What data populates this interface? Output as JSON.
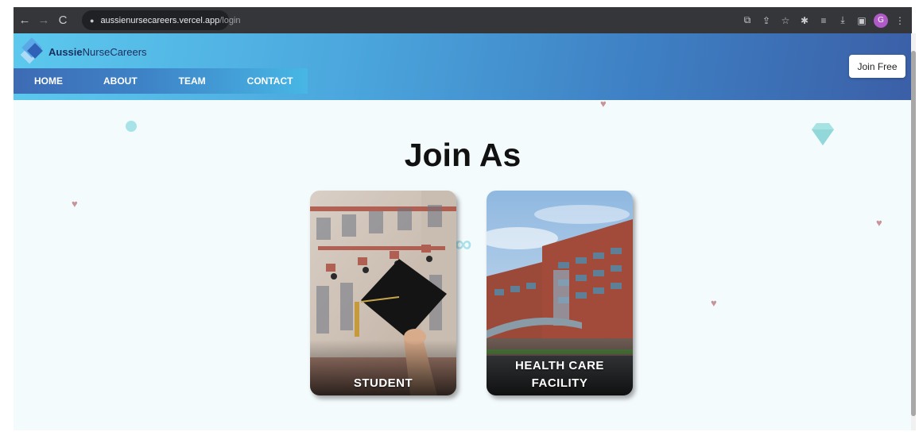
{
  "browser": {
    "url_host": "aussienursecareers.vercel.app",
    "url_path": "/login",
    "back_icon": "←",
    "forward_icon": "→",
    "reload_icon": "C",
    "lock_icon": "🔒",
    "toolbar_icons": [
      "⧉",
      "⇪",
      "☆",
      "✱",
      "≡",
      "⤓",
      "▣",
      "⋮"
    ],
    "profile_initial": "G"
  },
  "header": {
    "brand_part1": "Aussie",
    "brand_part2": "NurseCareers",
    "nav": [
      {
        "label": "HOME"
      },
      {
        "label": "ABOUT"
      },
      {
        "label": "TEAM"
      },
      {
        "label": "CONTACT"
      }
    ],
    "join_button": "Join Free"
  },
  "main": {
    "title": "Join As",
    "cards": [
      {
        "label_line1": "STUDENT",
        "label_line2": ""
      },
      {
        "label_line1": "HEALTH CARE",
        "label_line2": "FACILITY"
      }
    ],
    "infinity_symbol": "∞"
  },
  "colors": {
    "page_bg": "#f4fbfd",
    "header_start": "#5cc9ee",
    "header_end": "#3b5fa7",
    "heart": "#c79499",
    "accent_cyan": "#a9e2ea"
  }
}
